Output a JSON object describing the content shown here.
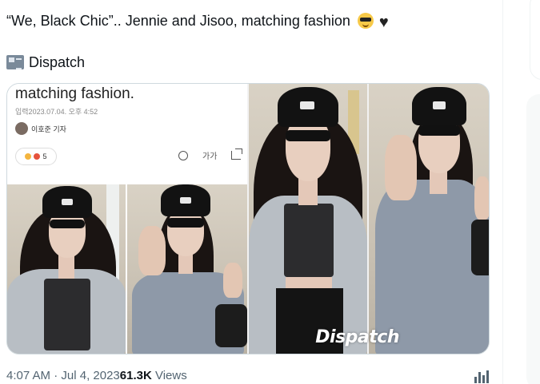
{
  "tweet": {
    "text": "“We, Black Chic”.. Jennie and Jisoo, matching fashion",
    "emoji_1": "sunglasses-face",
    "emoji_2": "black-heart",
    "source_label": "Dispatch",
    "time": "4:07 AM",
    "separator": " · ",
    "date": "Jul 4, 2023",
    "views_count": "61.3K",
    "views_label": " Views"
  },
  "article": {
    "title": "matching fashion.",
    "date": "입력2023.07.04. 오후 4:52",
    "reporter": "이호준 기자",
    "reaction_count": "5",
    "font_size_label": "가가"
  },
  "watermark": "Dispatch",
  "colors": {
    "text": "#0f1419",
    "secondary": "#536471",
    "border": "#cfd9de"
  }
}
